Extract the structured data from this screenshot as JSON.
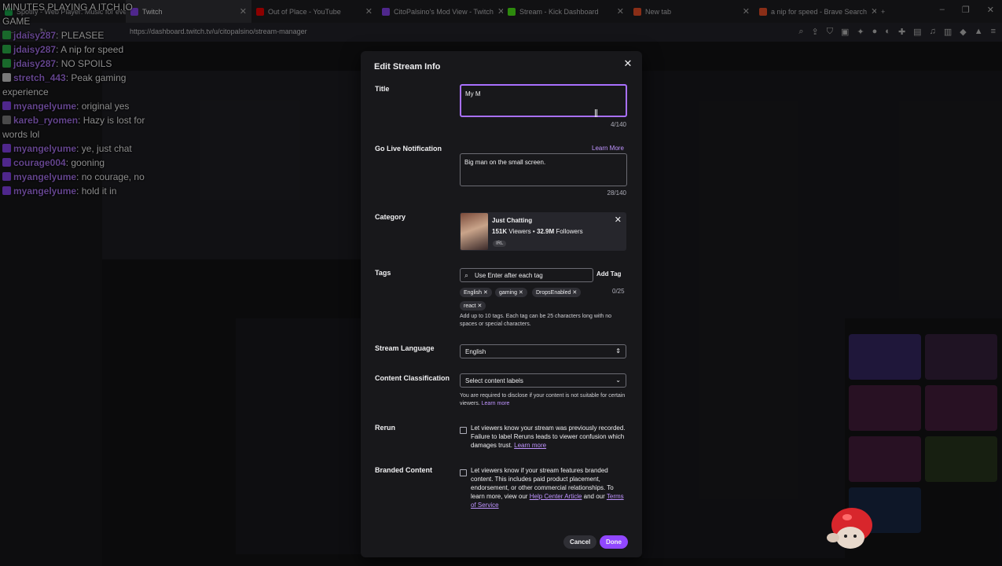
{
  "browser": {
    "tabs": [
      {
        "label": "Spotify - Web Player: Music for every...",
        "color": "#1db954"
      },
      {
        "label": "Twitch",
        "color": "#9147ff",
        "active": true
      },
      {
        "label": "Out of Place - YouTube",
        "color": "#ff0000"
      },
      {
        "label": "CitoPalsino's Mod View - Twitch",
        "color": "#9147ff"
      },
      {
        "label": "Stream - Kick Dashboard",
        "color": "#53fc18"
      },
      {
        "label": "New tab",
        "color": "#fb542b"
      },
      {
        "label": "a nip for speed - Brave Search",
        "color": "#fb542b"
      }
    ],
    "new_tab": "+",
    "url": "https://dashboard.twitch.tv/u/citopalsino/stream-manager"
  },
  "chat": [
    {
      "user": "",
      "text": "MINUTES PLAYING A ITCH.IO GAME"
    },
    {
      "user": "jdaisy287",
      "text": "PLEASEE",
      "badge": "#2fbf4f"
    },
    {
      "user": "jdaisy287",
      "text": "A nip for speed",
      "badge": "#2fbf4f"
    },
    {
      "user": "jdaisy287",
      "text": "NO SPOILS",
      "badge": "#2fbf4f"
    },
    {
      "user": "stretch_443",
      "text": "Peak gaming experience",
      "badge": "#dddddd"
    },
    {
      "user": "myangelyume",
      "text": "original yes",
      "badge": "#9147ff"
    },
    {
      "user": "kareb_ryomen",
      "text": "Hazy is lost for words lol",
      "badge": "#888888"
    },
    {
      "user": "myangelyume",
      "text": "ye, just chat",
      "badge": "#9147ff"
    },
    {
      "user": "courage004",
      "text": "gooning",
      "badge": "#9147ff"
    },
    {
      "user": "myangelyume",
      "text": "no courage, no",
      "badge": "#9147ff"
    },
    {
      "user": "myangelyume",
      "text": "hold it in",
      "badge": "#9147ff"
    }
  ],
  "modal": {
    "title": "Edit Stream Info",
    "close": "✕",
    "title_label": "Title",
    "title_value": "My M",
    "title_count": "4/140",
    "notif_label": "Go Live Notification",
    "learn_more": "Learn More",
    "notif_value": "Big man on the small screen.",
    "notif_count": "28/140",
    "category_label": "Category",
    "category": {
      "name": "Just Chatting",
      "viewers": "151K",
      "viewers_label": "Viewers",
      "followers": "32.9M",
      "followers_label": "Followers",
      "tag": "IRL"
    },
    "tags_label": "Tags",
    "tags_placeholder": "Use Enter after each tag",
    "add_tag": "Add Tag",
    "tags": [
      "English",
      "gaming",
      "DropsEnabled",
      "react"
    ],
    "tags_count": "0/25",
    "tags_help": "Add up to 10 tags. Each tag can be 25 characters long with no spaces or special characters.",
    "language_label": "Stream Language",
    "language_value": "English",
    "classification_label": "Content Classification",
    "classification_value": "Select content labels",
    "classification_help": "You are required to disclose if your content is not suitable for certain viewers.",
    "classification_link": "Learn more",
    "rerun_label": "Rerun",
    "rerun_text": "Let viewers know your stream was previously recorded. Failure to label Reruns leads to viewer confusion which damages trust.",
    "rerun_link": "Learn more",
    "branded_label": "Branded Content",
    "branded_text": "Let viewers know if your stream features branded content. This includes paid product placement, endorsement, or other commercial relationships. To learn more, view our",
    "branded_link1": "Help Center Article",
    "branded_and": "and our",
    "branded_link2": "Terms of Service",
    "cancel": "Cancel",
    "done": "Done"
  },
  "accent": "#9147ff"
}
